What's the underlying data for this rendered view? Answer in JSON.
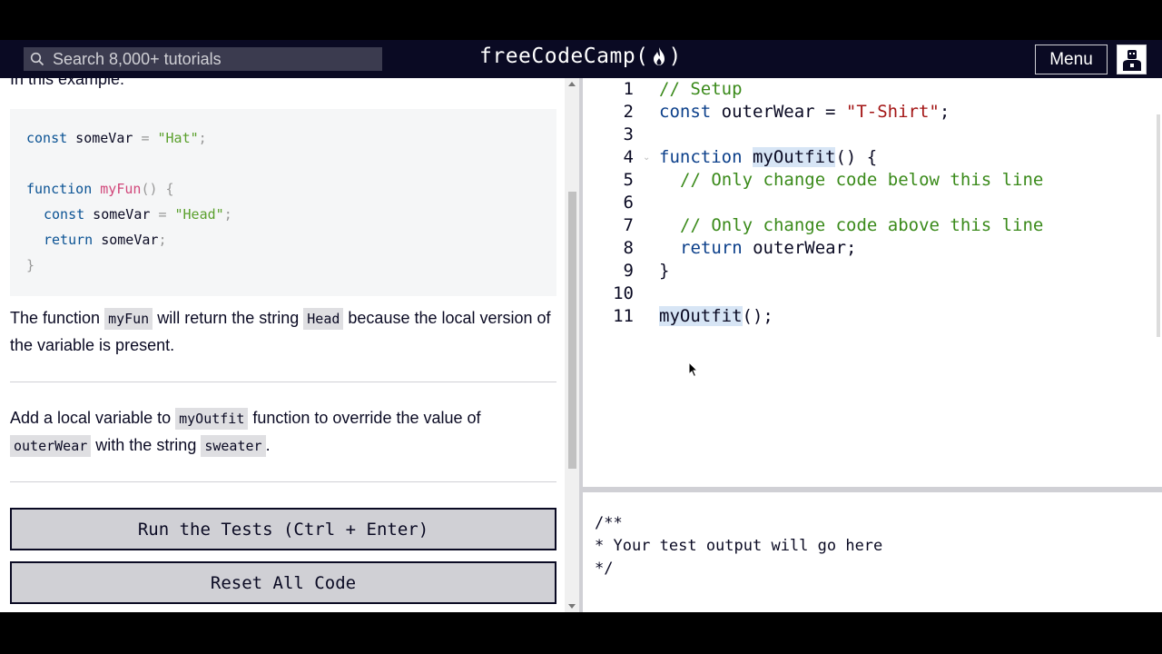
{
  "navbar": {
    "search_placeholder": "Search 8,000+ tutorials",
    "brand_left": "freeCodeCamp(",
    "brand_right": ")",
    "menu_label": "Menu"
  },
  "lesson": {
    "cut_text": "In this example:",
    "example_code": [
      {
        "k": "const",
        "v": " someVar ",
        "o": "=",
        "s": " \"Hat\"",
        "p": ";"
      },
      {
        "k": "function",
        "f": " myFun",
        "p": "() {"
      },
      {
        "k": "const",
        "v": " someVar ",
        "o": "=",
        "s": " \"Head\"",
        "p": ";"
      },
      {
        "k": "return",
        "v": " someVar",
        "p": ";"
      },
      {
        "p": "}"
      }
    ],
    "para1": {
      "t1": "The function ",
      "c1": "myFun",
      "t2": " will return the string ",
      "c2": "Head",
      "t3": " because the local version of the variable is present."
    },
    "para2": {
      "t1": "Add a local variable to ",
      "c1": "myOutfit",
      "t2": " function to override the value of ",
      "c2": "outerWear",
      "t3": " with the string ",
      "c3": "sweater",
      "t4": "."
    },
    "run_button": "Run the Tests (Ctrl + Enter)",
    "reset_button": "Reset All Code"
  },
  "editor": {
    "line_numbers": [
      "1",
      "2",
      "3",
      "4",
      "5",
      "6",
      "7",
      "8",
      "9",
      "10",
      "11"
    ],
    "lines": {
      "l1": "// Setup",
      "l2_kw": "const",
      "l2_rest": " outerWear = ",
      "l2_str": "\"T-Shirt\"",
      "l2_end": ";",
      "l4_kw": "function",
      "l4_fn": "myOutfit",
      "l4_end": "() {",
      "l5": "// Only change code below this line",
      "l7": "// Only change code above this line",
      "l8_kw": "return",
      "l8_rest": " outerWear;",
      "l9": "}",
      "l11_fn": "myOutfit",
      "l11_end": "();"
    }
  },
  "output": {
    "lines": [
      "/**",
      "* Your test output will go here",
      "*/"
    ]
  },
  "colors": {
    "navbar_bg": "#0a0a23",
    "search_bg": "#3b3b4f",
    "button_bg": "#d0d0d5",
    "comment": "#3a8a1a"
  }
}
